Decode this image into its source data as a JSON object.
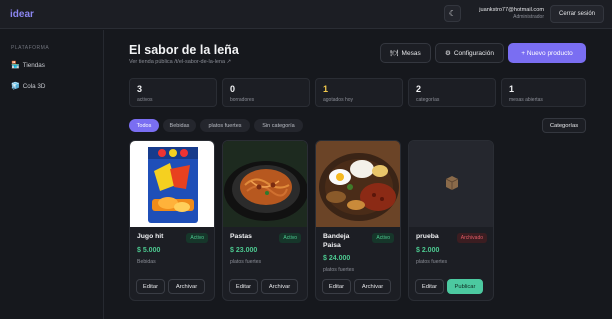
{
  "app": {
    "logo": "idear"
  },
  "header": {
    "theme_icon": "moon-icon",
    "user_email": "juankstro77@hotmail.com",
    "user_role": "Administrador",
    "logout_label": "Cerrar sesión"
  },
  "sidebar": {
    "section_label": "PLATAFORMA",
    "items": [
      {
        "label": "Tiendas",
        "icon": "store-icon"
      },
      {
        "label": "Cola 3D",
        "icon": "queue-icon"
      }
    ]
  },
  "page": {
    "title": "El sabor de la leña",
    "subtitle": "Ver tienda pública /t/el-sabor-de-la-lena ↗",
    "actions": {
      "mesas": "Mesas",
      "config": "Configuración",
      "new_product": "+ Nuevo producto"
    }
  },
  "stats": [
    {
      "value": "3",
      "label": "activos"
    },
    {
      "value": "0",
      "label": "borradores"
    },
    {
      "value": "1",
      "label": "agotados hoy",
      "color": "#f2c94c"
    },
    {
      "value": "2",
      "label": "categorías"
    },
    {
      "value": "1",
      "label": "mesas abiertas"
    }
  ],
  "filters": {
    "chips": [
      "Todos",
      "Bebidas",
      "platos fuertes",
      "Sin categoría"
    ],
    "active": "Todos",
    "categories_button": "Categorías"
  },
  "products": [
    {
      "name": "Jugo hit",
      "status": "Activo",
      "price": "$ 5.000",
      "category": "Bebidas",
      "actions": [
        "Editar",
        "Archivar"
      ]
    },
    {
      "name": "Pastas",
      "status": "Activo",
      "price": "$ 23.000",
      "category": "platos fuertes",
      "actions": [
        "Editar",
        "Archivar"
      ]
    },
    {
      "name": "Bandeja Paisa",
      "status": "Activo",
      "price": "$ 24.000",
      "category": "platos fuertes",
      "actions": [
        "Editar",
        "Archivar"
      ]
    },
    {
      "name": "prueba",
      "status": "Archivado",
      "price": "$ 2.000",
      "category": "platos fuertes",
      "actions": [
        "Editar",
        "Publicar"
      ]
    }
  ],
  "colors": {
    "accent": "#7a6ef2",
    "price": "#4cc990",
    "archived": "#e05b66"
  }
}
